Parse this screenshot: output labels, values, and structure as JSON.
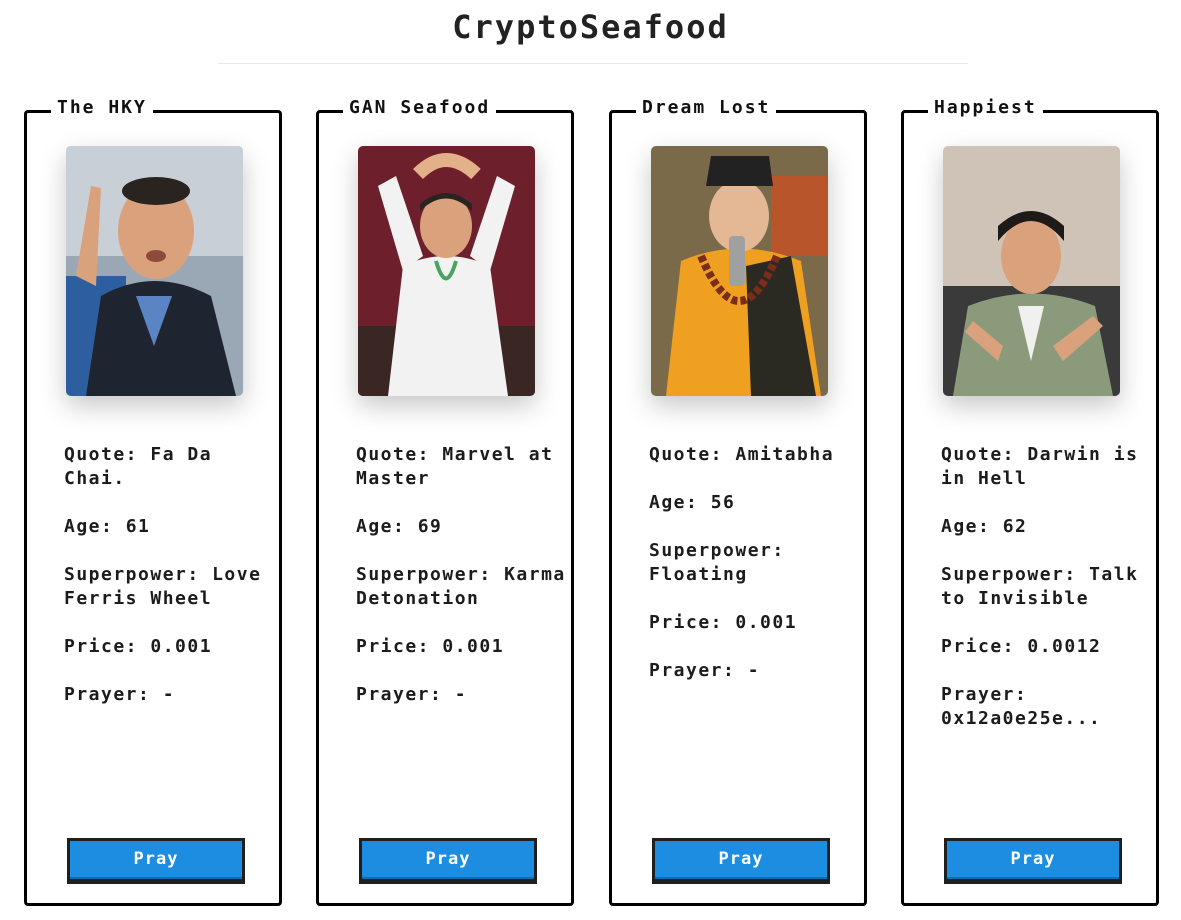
{
  "app": {
    "title": "CryptoSeafood"
  },
  "labels": {
    "quote": "Quote:",
    "age": "Age:",
    "superpower": "Superpower:",
    "price": "Price:",
    "prayer": "Prayer:"
  },
  "cards": [
    {
      "title": "The HKY",
      "quote": "Fa Da Chai.",
      "age": "61",
      "superpower": "Love Ferris Wheel",
      "price": "0.001",
      "prayer": "-",
      "button": "Pray"
    },
    {
      "title": "GAN Seafood",
      "quote": "Marvel at Master",
      "age": "69",
      "superpower": "Karma Detonation",
      "price": "0.001",
      "prayer": "-",
      "button": "Pray"
    },
    {
      "title": "Dream Lost",
      "quote": "Amitabha",
      "age": "56",
      "superpower": "Floating",
      "price": "0.001",
      "prayer": "-",
      "button": "Pray"
    },
    {
      "title": "Happiest",
      "quote": "Darwin is in Hell",
      "age": "62",
      "superpower": "Talk to Invisible",
      "price": "0.0012",
      "prayer": "0x12a0e25e...",
      "button": "Pray"
    }
  ],
  "colors": {
    "button": "#1c8de0",
    "border": "#000000"
  }
}
